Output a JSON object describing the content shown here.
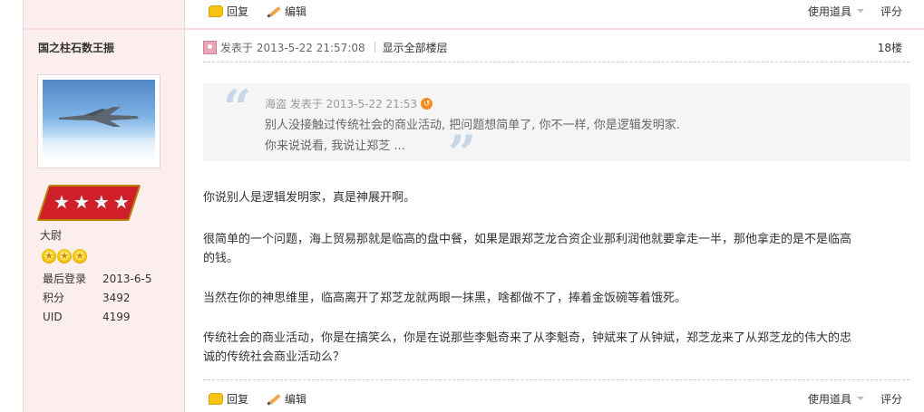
{
  "prev_post": {
    "reply_label": "回复",
    "edit_label": "编辑",
    "tools_label": "使用道具",
    "rate_label": "评分"
  },
  "user": {
    "name": "国之柱石数王振",
    "avatar_watermark": "",
    "rank_title": "大尉",
    "stats": [
      {
        "key": "最后登录",
        "value": "2013-6-5"
      },
      {
        "key": "积分",
        "value": "3492"
      },
      {
        "key": "UID",
        "value": "4199"
      }
    ]
  },
  "post": {
    "posted_at": "发表于 2013-5-22 21:57:08",
    "show_all_floors": "显示全部楼层",
    "floor": "18楼",
    "quote": {
      "meta": "海盗 发表于 2013-5-22 21:53",
      "line1": "别人没接触过传统社会的商业活动, 把问题想简单了, 你不一样, 你是逻辑发明家.",
      "line2": "你来说说看, 我说让郑芝 ..."
    },
    "paragraphs": [
      "你说别人是逻辑发明家，真是神展开啊。",
      "很简单的一个问题，海上贸易那就是临高的盘中餐，如果是跟郑芝龙合资企业那利润他就要拿走一半，那他拿走的是不是临高",
      "的钱。",
      "当然在你的神思维里，临高离开了郑芝龙就两眼一抹黑，啥都做不了，捧着金饭碗等着饿死。",
      "传统社会的商业活动，你是在搞笑么，你是在说那些李魁奇来了从李魁奇，钟斌来了从钟斌，郑芝龙来了从郑芝龙的伟大的忠",
      "诚的传统社会商业活动么？"
    ],
    "reply_label": "回复",
    "edit_label": "编辑",
    "tools_label": "使用道具",
    "rate_label": "评分"
  },
  "colors": {
    "left_panel_bg": "#fdeeee",
    "quote_bg": "#f5f5f5",
    "rank_badge": "#d11f2a",
    "reply_icon": "#f7c416"
  }
}
